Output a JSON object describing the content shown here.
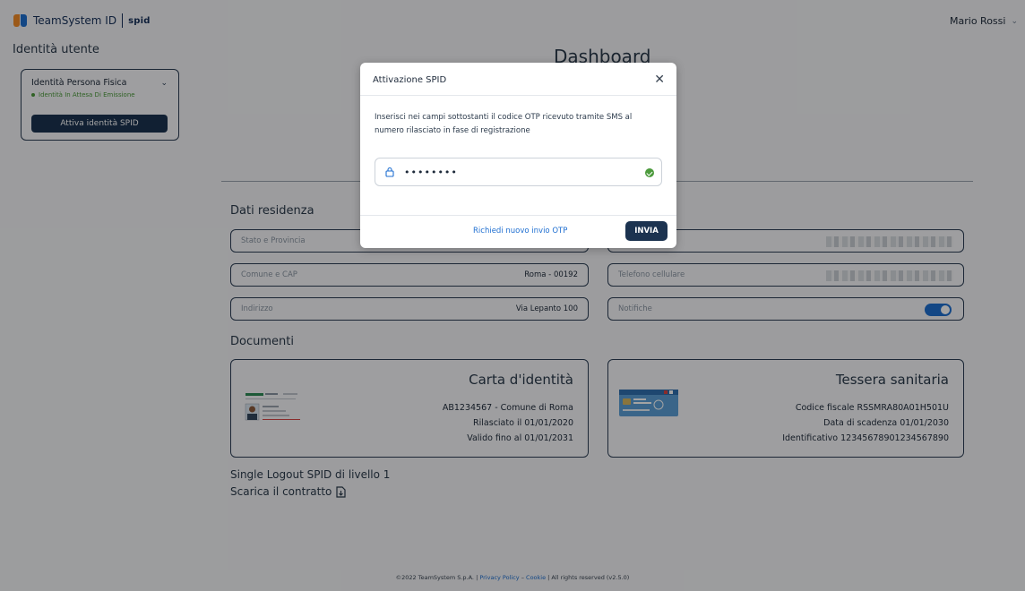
{
  "header": {
    "brand": "TeamSystem ID",
    "brand_product": "spid",
    "user_name": "Mario Rossi"
  },
  "sidebar": {
    "title": "Identità utente",
    "identity_card": {
      "title": "Identità Persona Fisica",
      "status": "Identità In Attesa Di Emissione",
      "button_label": "Attiva identità SPID"
    }
  },
  "main": {
    "title": "Dashboard",
    "residence": {
      "section_title": "Dati residenza",
      "fields": [
        {
          "label": "Stato e Provincia",
          "value": ""
        },
        {
          "label": "Comune e CAP",
          "value": "Roma - 00192"
        },
        {
          "label": "Indirizzo",
          "value": "Via Lepanto 100"
        }
      ],
      "right_fields": [
        {
          "label": "",
          "value": ""
        },
        {
          "label": "Telefono cellulare",
          "value": ""
        },
        {
          "label": "Notifiche",
          "value": ""
        }
      ]
    },
    "documents": {
      "section_title": "Documenti",
      "id_card": {
        "title": "Carta d'identità",
        "line1": "AB1234567 - Comune di Roma",
        "line2": "Rilasciato il 01/01/2020",
        "line3": "Valido fino al 01/01/2031"
      },
      "health_card": {
        "title": "Tessera sanitaria",
        "line1": "Codice fiscale RSSMRA80A01H501U",
        "line2": "Data di scadenza 01/01/2030",
        "line3": "Identificativo 12345678901234567890"
      }
    },
    "logout_label": "Single Logout SPID di livello 1",
    "contract_label": "Scarica il contratto"
  },
  "footer": {
    "copyright": "©2022 TeamSystem S.p.A. | ",
    "privacy": "Privacy Policy",
    "dash": " – ",
    "cookie": "Cookie",
    "rights": " | All rights reserved (v2.5.0)"
  },
  "modal": {
    "title": "Attivazione SPID",
    "message": "Inserisci nei campi sottostanti il codice OTP ricevuto tramite SMS al numero rilasciato in fase di registrazione",
    "otp_value": "••••••••",
    "resend_link": "Richiedi nuovo invio OTP",
    "submit_label": "INVIA"
  },
  "colors": {
    "primary": "#1c3350",
    "accent": "#1f6fd1",
    "success": "#4c9a3c"
  }
}
